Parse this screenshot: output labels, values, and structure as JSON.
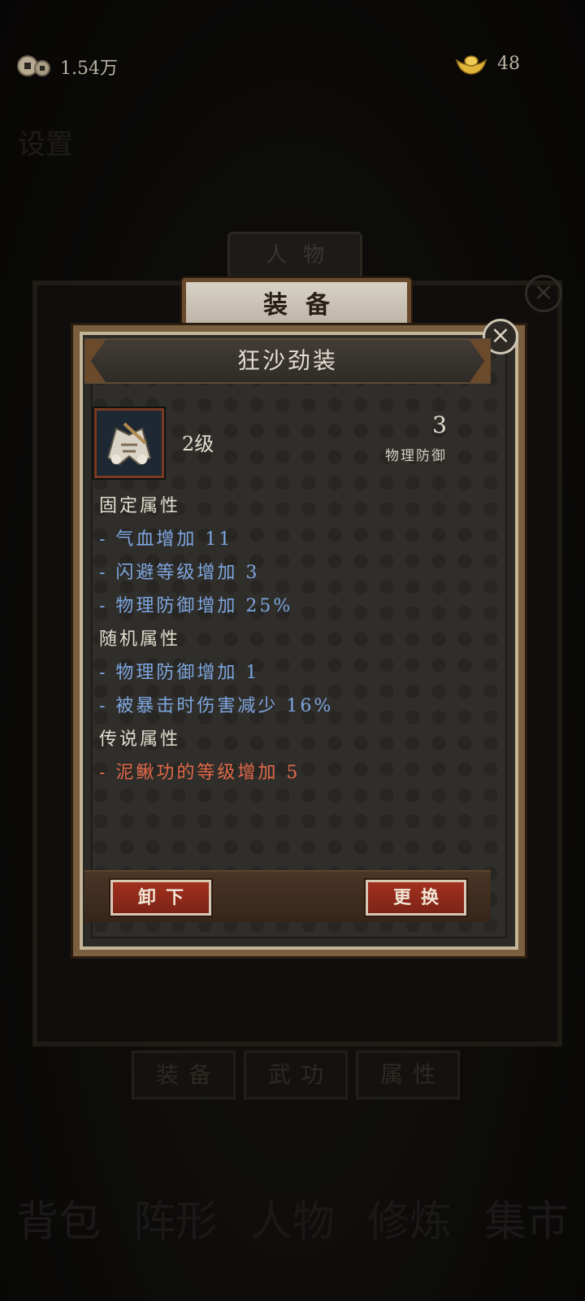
{
  "topbar": {
    "coins": "1.54万",
    "ingots": "48"
  },
  "background": {
    "settings_label": "设置",
    "person_tab": "人物",
    "tabs": [
      "装备",
      "武功",
      "属性"
    ],
    "nav": [
      "背包",
      "阵形",
      "人物",
      "修炼",
      "集市"
    ]
  },
  "equip_tab": "装备",
  "item": {
    "name": "狂沙劲装",
    "level": "2级",
    "stat_value": "3",
    "stat_label": "物理防御",
    "fixed_header": "固定属性",
    "fixed": [
      "- 气血增加 11",
      "- 闪避等级增加 3",
      "- 物理防御增加 25%"
    ],
    "random_header": "随机属性",
    "random": [
      "- 物理防御增加 1",
      "- 被暴击时伤害减少 16%"
    ],
    "legend_header": "传说属性",
    "legend": [
      "- 泥鳅功的等级增加 5"
    ]
  },
  "buttons": {
    "unequip": "卸下",
    "replace": "更换"
  },
  "colors": {
    "blue_attr": "#7ea6e0",
    "legend_attr": "#e2694a",
    "button_red": "#a3301e"
  }
}
